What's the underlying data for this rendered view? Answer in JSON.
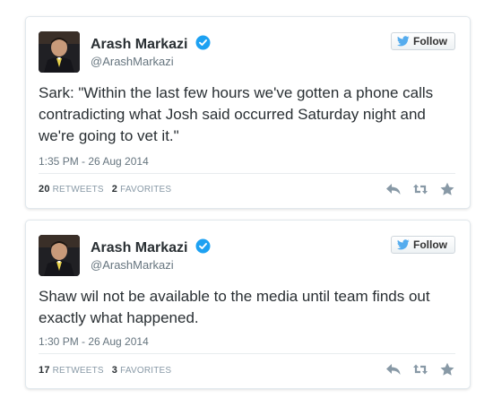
{
  "tweets": [
    {
      "author_name": "Arash Markazi",
      "handle": "@ArashMarkazi",
      "follow_label": "Follow",
      "text": "Sark: \"Within the last few hours we've gotten a phone calls contradicting what Josh said occurred Saturday night and we're going to vet it.\"",
      "timestamp": "1:35 PM - 26 Aug 2014",
      "retweets": "20",
      "retweets_label": "RETWEETS",
      "favorites": "2",
      "favorites_label": "FAVORITES"
    },
    {
      "author_name": "Arash Markazi",
      "handle": "@ArashMarkazi",
      "follow_label": "Follow",
      "text": "Shaw wil not be available to the media until team finds out exactly what happened.",
      "timestamp": "1:30 PM - 26 Aug 2014",
      "retweets": "17",
      "retweets_label": "RETWEETS",
      "favorites": "3",
      "favorites_label": "FAVORITES"
    }
  ],
  "colors": {
    "twitter_blue": "#55acee",
    "verified_blue": "#1da1f2",
    "text": "#292f33",
    "muted": "#66757f"
  },
  "icons": {
    "verified": "verified-badge-icon",
    "follow_bird": "twitter-bird-icon",
    "reply": "reply-icon",
    "retweet": "retweet-icon",
    "favorite": "star-icon"
  }
}
